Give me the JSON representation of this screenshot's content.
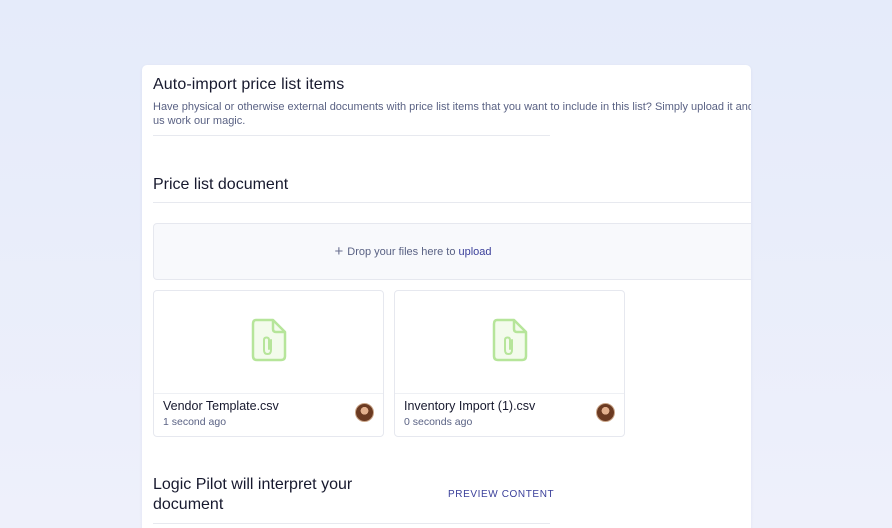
{
  "auto_import": {
    "title": "Auto-import price list items",
    "description": "Have physical or otherwise external documents with price list items that you want to include in this list? Simply upload it and let us work our magic."
  },
  "document_section": {
    "title": "Price list document"
  },
  "dropzone": {
    "icon": "plus-icon",
    "text": "Drop your files here to",
    "link": "upload"
  },
  "files": [
    {
      "name": "Vendor Template.csv",
      "time": "1 second ago",
      "icon": "attachment-file-icon",
      "avatar": "user-avatar"
    },
    {
      "name": "Inventory Import (1).csv",
      "time": "0 seconds ago",
      "icon": "attachment-file-icon",
      "avatar": "user-avatar"
    }
  ],
  "interpret_section": {
    "title": "Logic Pilot will interpret your document",
    "preview_label": "PREVIEW CONTENT"
  },
  "colors": {
    "accent": "#3a3f9a",
    "file_icon": "#b6e59a"
  }
}
